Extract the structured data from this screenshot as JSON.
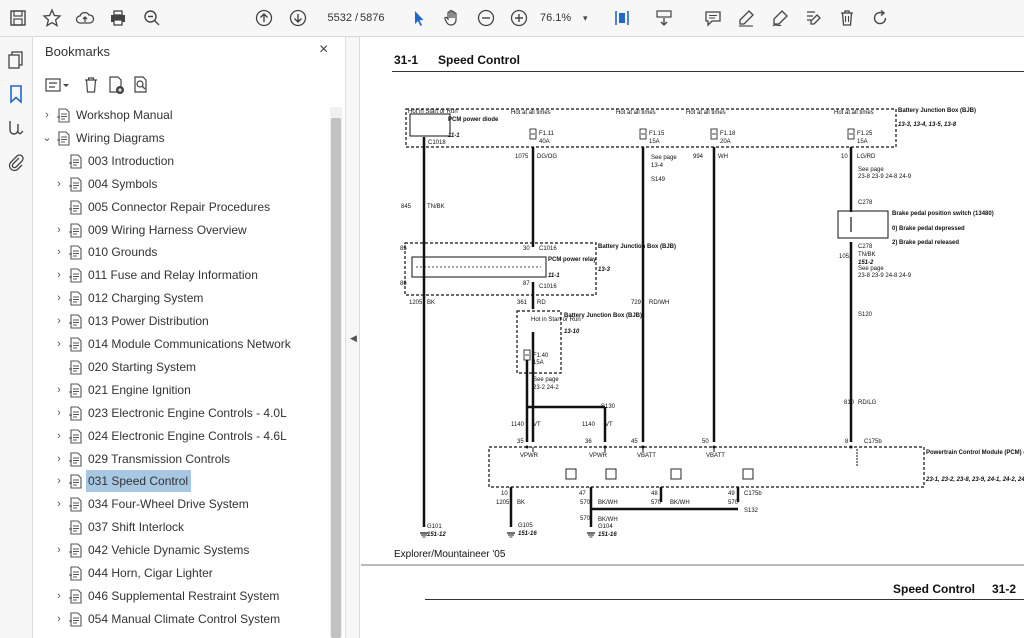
{
  "toolbar": {
    "page_current": "5532",
    "page_separator": "/",
    "page_total": "5876",
    "zoom": "76.1%",
    "icons": [
      "save-icon",
      "star-icon",
      "upload-icon",
      "print-icon",
      "zoom-search-icon",
      "page-up-icon",
      "page-down-icon",
      "select-cursor-icon",
      "hand-icon",
      "zoom-out-icon",
      "zoom-in-icon",
      "fit-page-icon",
      "scroll-mode-icon",
      "comment-icon",
      "highlight-icon",
      "sign-icon",
      "edit-icon",
      "delete-icon",
      "rotate-icon"
    ]
  },
  "bookmarks": {
    "title": "Bookmarks",
    "close": "×",
    "items": [
      {
        "label": "Workshop Manual",
        "level": 0,
        "caret": "›"
      },
      {
        "label": "Wiring Diagrams",
        "level": 0,
        "caret": "⌄"
      },
      {
        "label": "003 Introduction",
        "level": 1,
        "caret": ""
      },
      {
        "label": "004 Symbols",
        "level": 1,
        "caret": "›"
      },
      {
        "label": "005  Connector Repair Procedures",
        "level": 1,
        "caret": ""
      },
      {
        "label": "009 Wiring Harness Overview",
        "level": 1,
        "caret": "›"
      },
      {
        "label": "010 Grounds",
        "level": 1,
        "caret": "›"
      },
      {
        "label": "011 Fuse and Relay Information",
        "level": 1,
        "caret": "›"
      },
      {
        "label": "012 Charging System",
        "level": 1,
        "caret": "›"
      },
      {
        "label": "013 Power Distribution",
        "level": 1,
        "caret": "›"
      },
      {
        "label": "014 Module Communications Network",
        "level": 1,
        "caret": "›"
      },
      {
        "label": "020 Starting System",
        "level": 1,
        "caret": ""
      },
      {
        "label": "021 Engine Ignition",
        "level": 1,
        "caret": "›"
      },
      {
        "label": "023 Electronic Engine Controls - 4.0L",
        "level": 1,
        "caret": "›"
      },
      {
        "label": "024 Electronic Engine Controls - 4.6L",
        "level": 1,
        "caret": "›"
      },
      {
        "label": "029 Transmission Controls",
        "level": 1,
        "caret": "›"
      },
      {
        "label": "031 Speed Control",
        "level": 1,
        "caret": "›",
        "selected": true
      },
      {
        "label": "034 Four-Wheel Drive System",
        "level": 1,
        "caret": "›"
      },
      {
        "label": "037 Shift Interlock",
        "level": 1,
        "caret": ""
      },
      {
        "label": "042 Vehicle Dynamic Systems",
        "level": 1,
        "caret": "›"
      },
      {
        "label": "044 Horn, Cigar Lighter",
        "level": 1,
        "caret": ""
      },
      {
        "label": "046 Supplemental Restraint System",
        "level": 1,
        "caret": "›"
      },
      {
        "label": "054 Manual Climate Control System",
        "level": 1,
        "caret": "›"
      }
    ]
  },
  "document": {
    "section": "31-1",
    "title": "Speed Control",
    "footer": "Explorer/Mountaineer '05",
    "next_title": "Speed Control",
    "next_section": "31-2",
    "diagram_labels": {
      "hot_start_run": "Hot in Start or Run",
      "pcm_diode": "PCM power diode",
      "ref_11_1": "11-1",
      "hot_all": "Hot at all times",
      "f111": "F1.11",
      "a40": "40A",
      "f115": "F1.15",
      "a15": "15A",
      "f118": "F1.18",
      "a20": "20A",
      "f125": "F1.25",
      "bjb": "Battery Junction Box (BJB)",
      "bjb_refs": "13-3, 13-4, 13-5, 13-8",
      "c1018": "C1018",
      "w1075": "1075",
      "dgog": "DG/OG",
      "see_page": "See page",
      "ref_13_4": "13-4",
      "s149": "S149",
      "w994": "994",
      "wh": "WH",
      "w10": "10",
      "lgrd": "LG/RD",
      "refs_23": "23-8 23-9 24-8 24-9",
      "c278": "C278",
      "bpps": "Brake pedal position switch (13480)",
      "bpps_0": "0)  Brake pedal depressed",
      "bpps_2": "2)  Brake pedal released",
      "w845": "845",
      "tnbk": "TN/BK",
      "w85": "85",
      "w30": "30",
      "c1016": "C1016",
      "bjb2": "Battery Junction Box (BJB)",
      "ref_13_3": "13-3",
      "pcm_relay": "PCM power relay",
      "w86": "86",
      "w87": "87",
      "w1052": "1052",
      "ref_151_2": "151-2",
      "w1205": "1205",
      "bk": "BK",
      "w361": "361",
      "rd": "RD",
      "w729": "729",
      "rdwh": "RD/WH",
      "bjb3": "Battery Junction Box (BJB)",
      "ref_13_10": "13-10",
      "s120": "S120",
      "f140": "F1.40",
      "ref_23_2": "23-2 24-2",
      "w810": "810",
      "rdlg": "RD/LG",
      "s130": "S130",
      "w1140": "1140",
      "vt": "VT",
      "w35": "35",
      "w36": "36",
      "w45": "45",
      "w50": "50",
      "w8": "8",
      "c175b": "C175b",
      "vpwr": "VPWR",
      "vbatt": "VBATT",
      "pcm": "Powertrain Control Module (PCM) (12A650)",
      "pcm_refs": "23-1, 23-2, 23-8, 23-9, 24-1, 24-2, 24-8, 24-9",
      "w47": "47",
      "w48": "48",
      "w49": "49",
      "w570": "570",
      "bkwh": "BK/WH",
      "s132": "S132",
      "g101": "G101",
      "g105": "G105",
      "g104": "G104",
      "ref_151_12": "151-12",
      "ref_151_16": "151-16"
    }
  }
}
